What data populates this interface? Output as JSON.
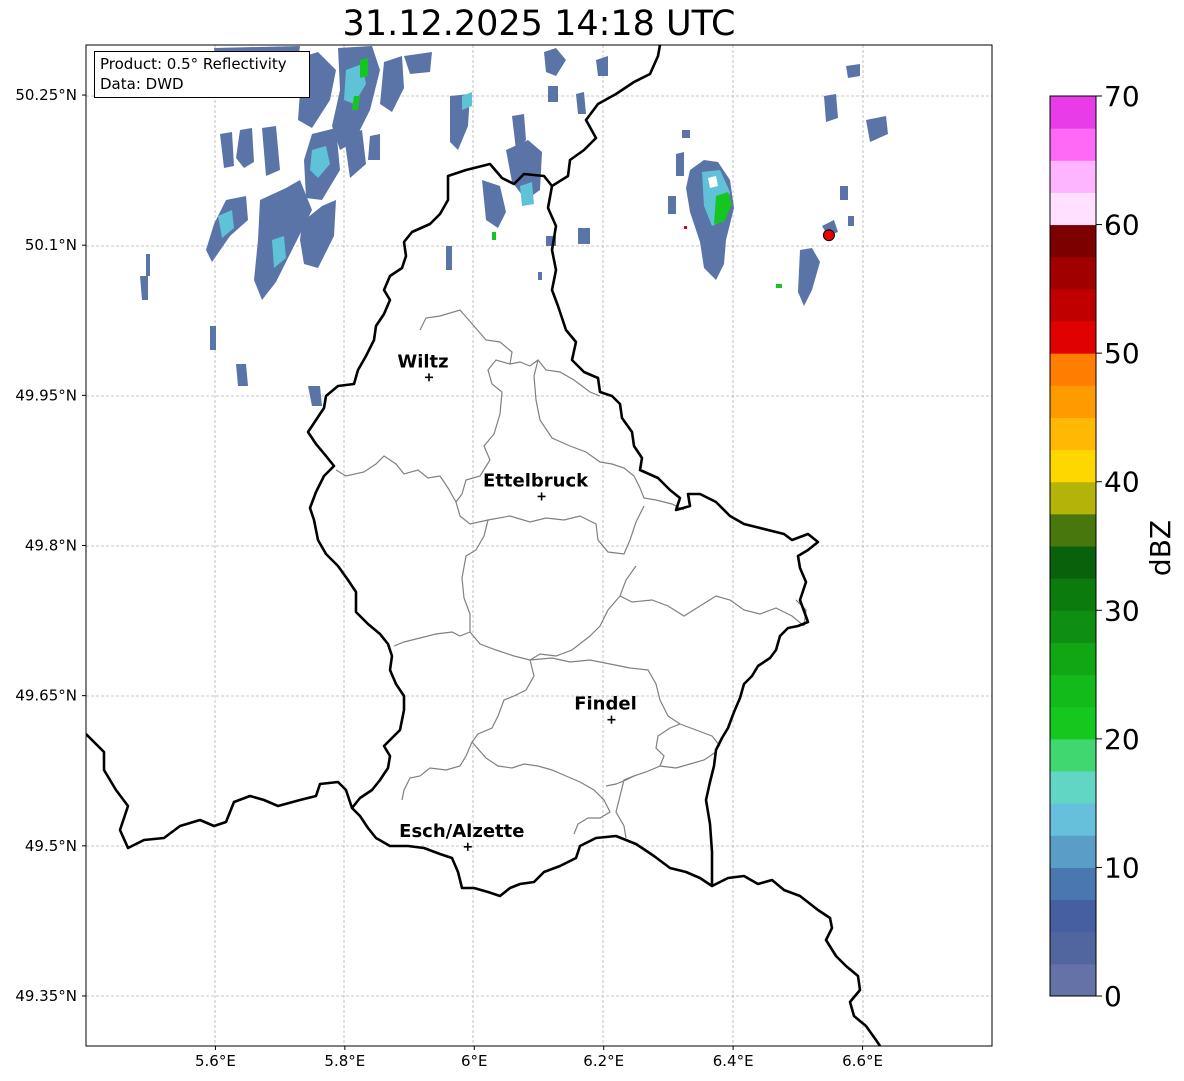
{
  "title": "31.12.2025 14:18 UTC",
  "info": {
    "product": "Product: 0.5° Reflectivity",
    "source": "Data: DWD"
  },
  "map": {
    "lon_range": [
      5.4,
      6.8
    ],
    "lat_range": [
      49.3,
      50.3
    ],
    "lat_ticks": [
      {
        "value": 50.25,
        "label": "50.25°N"
      },
      {
        "value": 50.1,
        "label": "50.1°N"
      },
      {
        "value": 49.95,
        "label": "49.95°N"
      },
      {
        "value": 49.8,
        "label": "49.8°N"
      },
      {
        "value": 49.65,
        "label": "49.65°N"
      },
      {
        "value": 49.5,
        "label": "49.5°N"
      },
      {
        "value": 49.35,
        "label": "49.35°N"
      }
    ],
    "lon_ticks": [
      {
        "value": 5.6,
        "label": "5.6°E"
      },
      {
        "value": 5.8,
        "label": "5.8°E"
      },
      {
        "value": 6.0,
        "label": "6°E"
      },
      {
        "value": 6.2,
        "label": "6.2°E"
      },
      {
        "value": 6.4,
        "label": "6.4°E"
      },
      {
        "value": 6.6,
        "label": "6.6°E"
      }
    ],
    "cities": [
      {
        "name": "Wiltz",
        "lon": 5.93,
        "lat": 49.968
      },
      {
        "name": "Ettelbruck",
        "lon": 6.104,
        "lat": 49.849
      },
      {
        "name": "Findel",
        "lon": 6.212,
        "lat": 49.626
      },
      {
        "name": "Esch/Alzette",
        "lon": 5.99,
        "lat": 49.499
      }
    ],
    "radar_site": {
      "lon": 6.548,
      "lat": 50.11
    }
  },
  "colorbar": {
    "label": "dBZ",
    "min": 0,
    "max": 70,
    "tick_labels": [
      "0",
      "10",
      "20",
      "30",
      "40",
      "50",
      "60",
      "70"
    ],
    "colors": [
      "#6472a8",
      "#51669f",
      "#455fa0",
      "#4a77b0",
      "#5a9ec8",
      "#66c0dc",
      "#62d6c5",
      "#40d670",
      "#14c81e",
      "#12bb1a",
      "#10a614",
      "#0e8f12",
      "#0b7b0e",
      "#0a610b",
      "#48780d",
      "#b3b30a",
      "#ffd700",
      "#ffb905",
      "#ff9b00",
      "#ff7d00",
      "#e00202",
      "#c00000",
      "#a00000",
      "#7c0000",
      "#ffe1ff",
      "#ffb4ff",
      "#ff69f5",
      "#e83ce8"
    ]
  }
}
